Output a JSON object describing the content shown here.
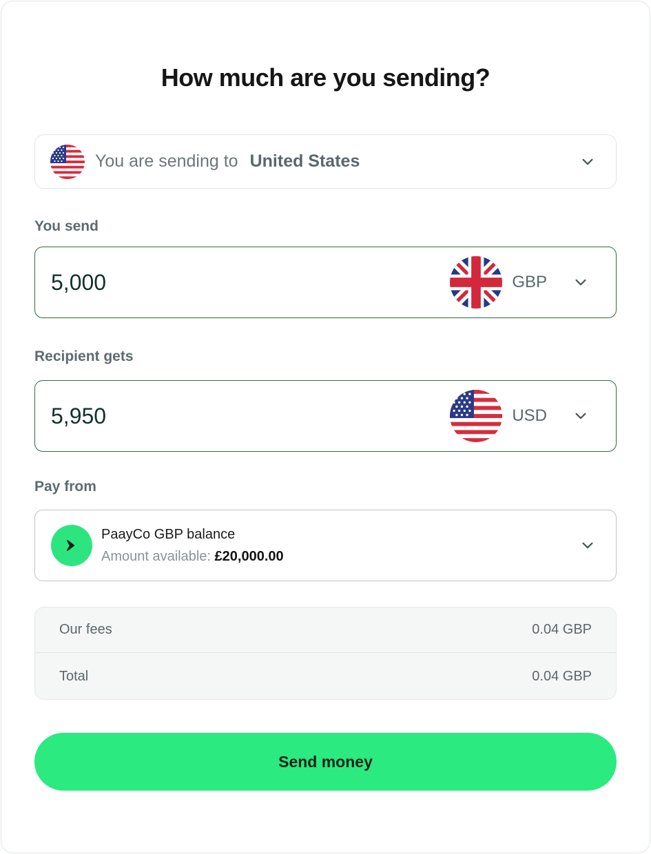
{
  "title": "How much are you sending?",
  "destination": {
    "label": "You are sending to",
    "country": "United States",
    "flag_icon": "us-flag-icon"
  },
  "send": {
    "label": "You send",
    "amount": "5,000",
    "currency": "GBP",
    "flag_icon": "uk-flag-icon"
  },
  "receive": {
    "label": "Recipient gets",
    "amount": "5,950",
    "currency": "USD",
    "flag_icon": "us-flag-icon"
  },
  "pay_from": {
    "label": "Pay from",
    "account_name": "PaayCo GBP balance",
    "available_label": "Amount available:",
    "available_amount": "£20,000.00",
    "logo_icon": "paayco-chevron-logo-icon"
  },
  "fees": {
    "rows": [
      {
        "label": "Our fees",
        "value": "0.04 GBP"
      },
      {
        "label": "Total",
        "value": "0.04 GBP"
      }
    ]
  },
  "submit": {
    "label": "Send money"
  },
  "colors": {
    "accent": "#2bea80",
    "input_border": "#2e6b3d",
    "label": "#5e6b70"
  }
}
